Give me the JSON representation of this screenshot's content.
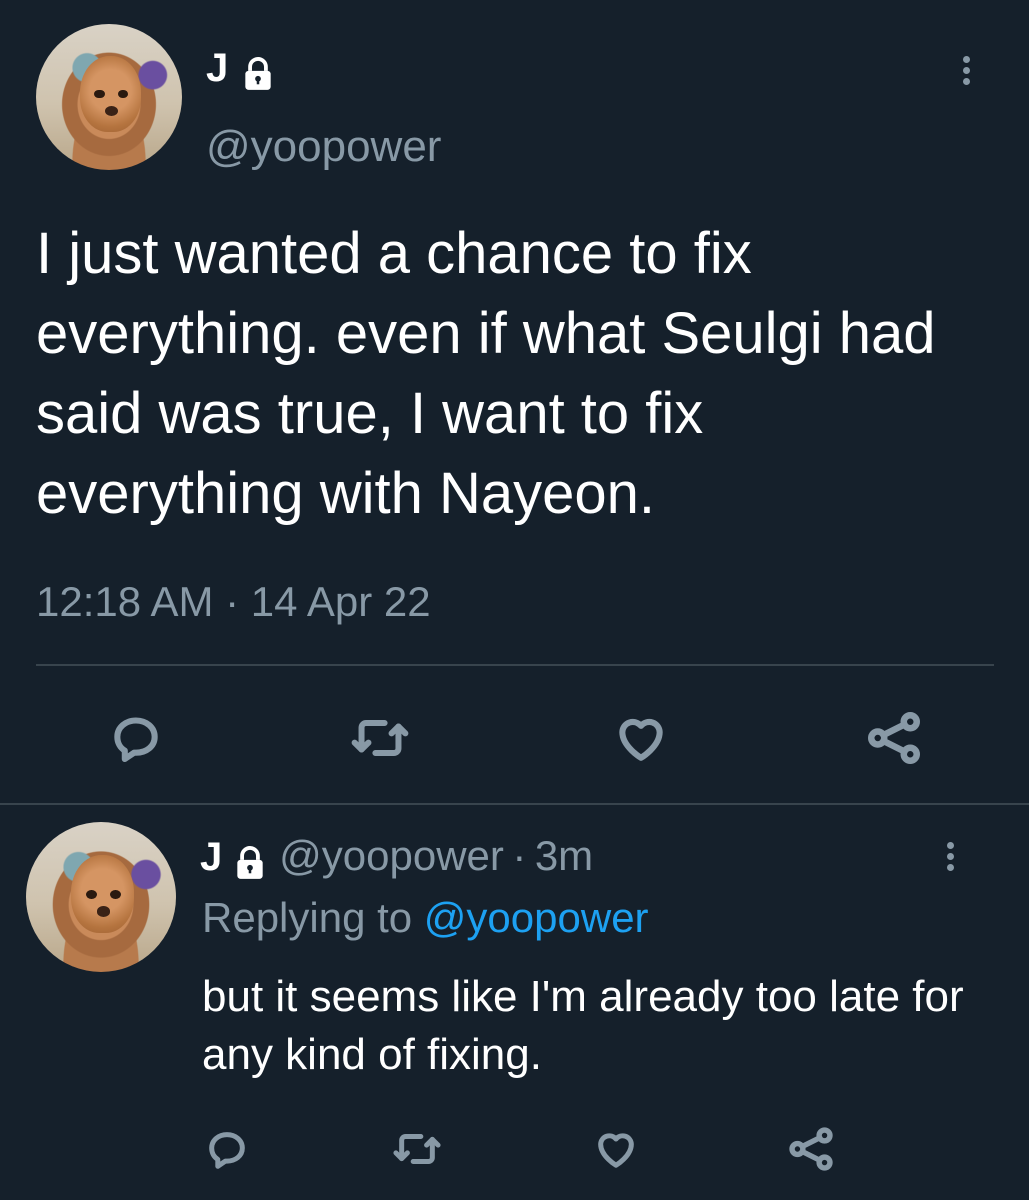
{
  "main_tweet": {
    "name": "J",
    "handle": "@yoopower",
    "text": "I just wanted a chance to fix everything. even if what Seulgi had said was true, I want to fix everything with Nayeon.",
    "timestamp": "12:18 AM · 14 Apr 22"
  },
  "reply_tweet": {
    "name": "J",
    "handle": "@yoopower",
    "separator": "·",
    "time_ago": "3m",
    "replying_prefix": "Replying to",
    "replying_handle": "@yoopower",
    "text": "but it seems like I'm already too late for any kind of fixing."
  },
  "icons": {
    "lock": "lock-icon",
    "more": "more-vertical-icon",
    "reply": "reply-icon",
    "retweet": "retweet-icon",
    "like": "heart-icon",
    "share": "share-icon"
  },
  "colors": {
    "background": "#15202b",
    "text": "#ffffff",
    "secondary": "#8899a6",
    "link": "#1da1f2",
    "divider": "#38444d"
  }
}
